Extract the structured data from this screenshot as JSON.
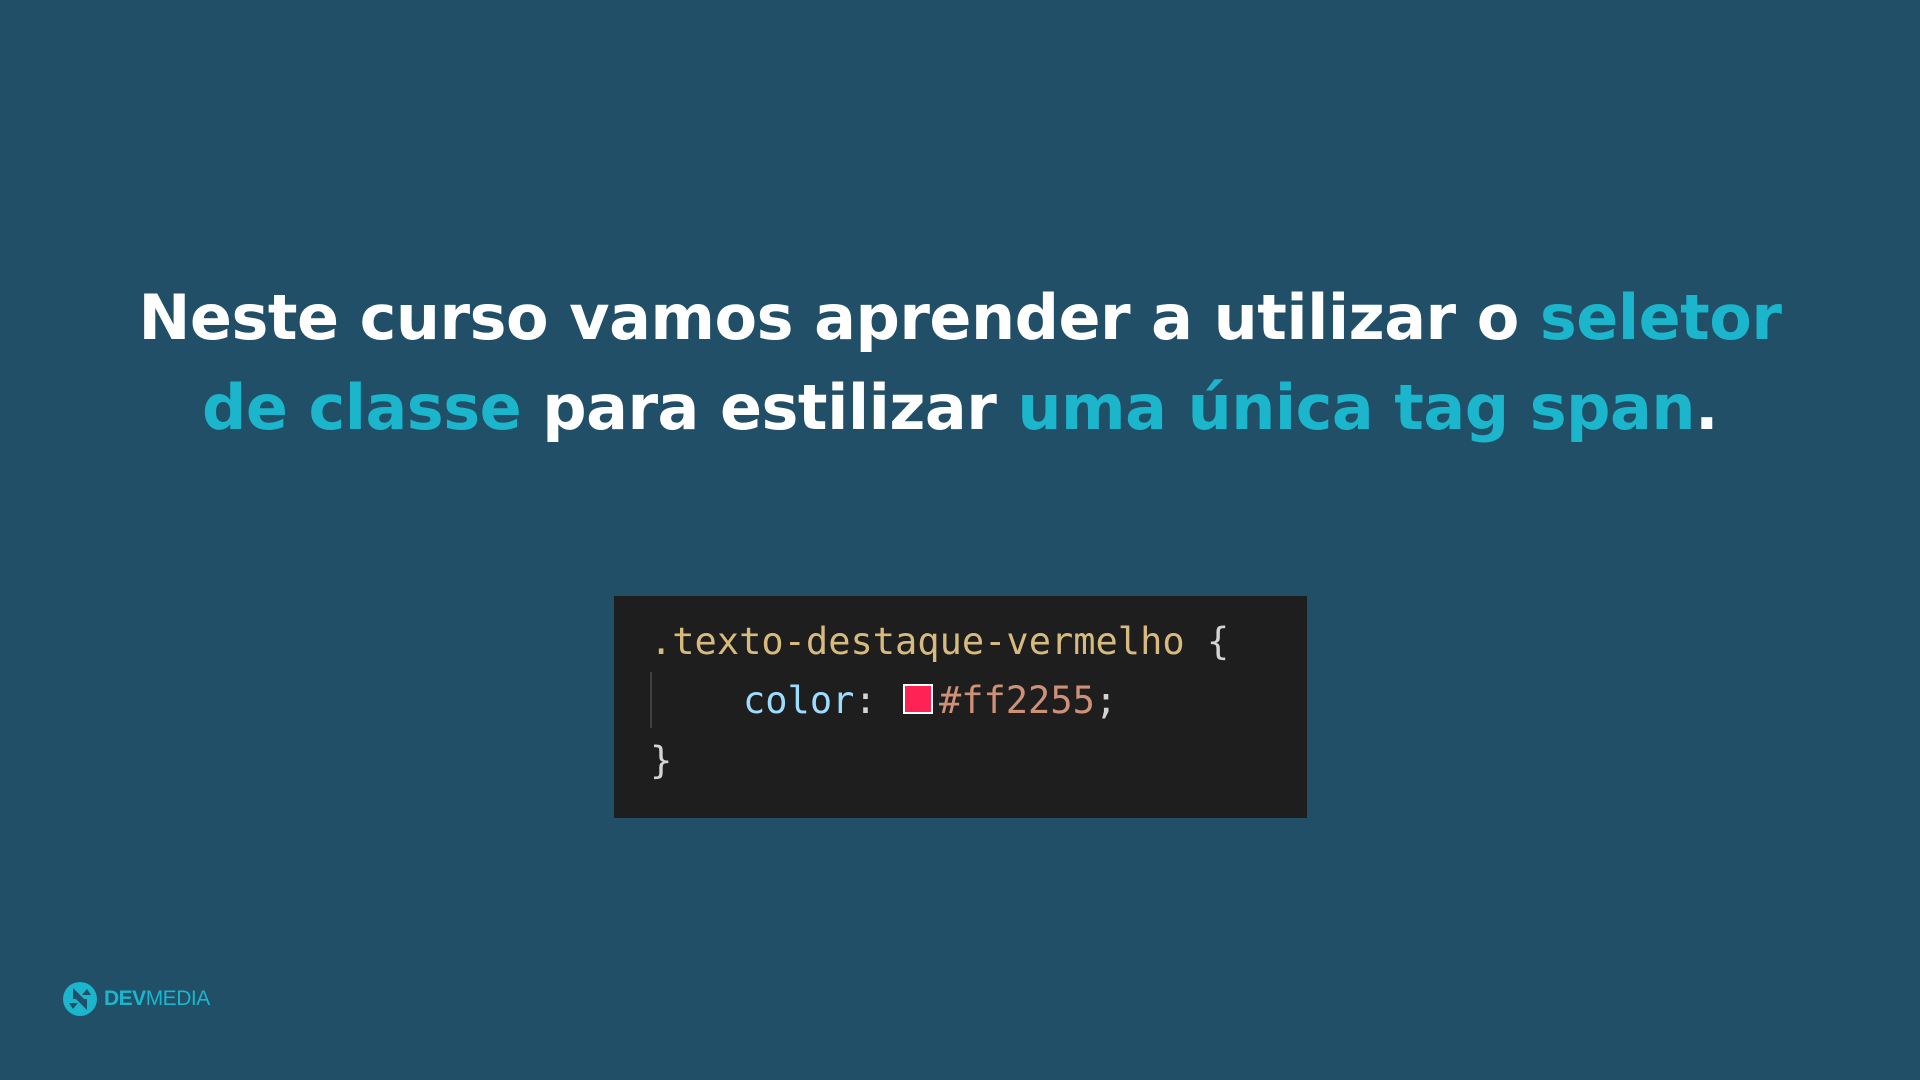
{
  "headline": {
    "line1_white": "Neste curso vamos aprender a utilizar o ",
    "line1_accent": "seletor",
    "line2_accent1": "de classe",
    "line2_white": " para estilizar ",
    "line2_accent2": "uma única tag span",
    "line2_end": "."
  },
  "code": {
    "selector": ".texto-destaque-vermelho",
    "open_brace": " {",
    "property": "color",
    "colon": ": ",
    "value": "#ff2255",
    "semicolon": ";",
    "close_brace": "}",
    "swatch_color": "#ff2255"
  },
  "logo": {
    "icon": "devmedia-logo-icon",
    "text_bold": "DEV",
    "text_light": "MEDIA"
  },
  "colors": {
    "background": "#214f67",
    "accent": "#1bb6cc",
    "code_background": "#1e1e1e"
  }
}
